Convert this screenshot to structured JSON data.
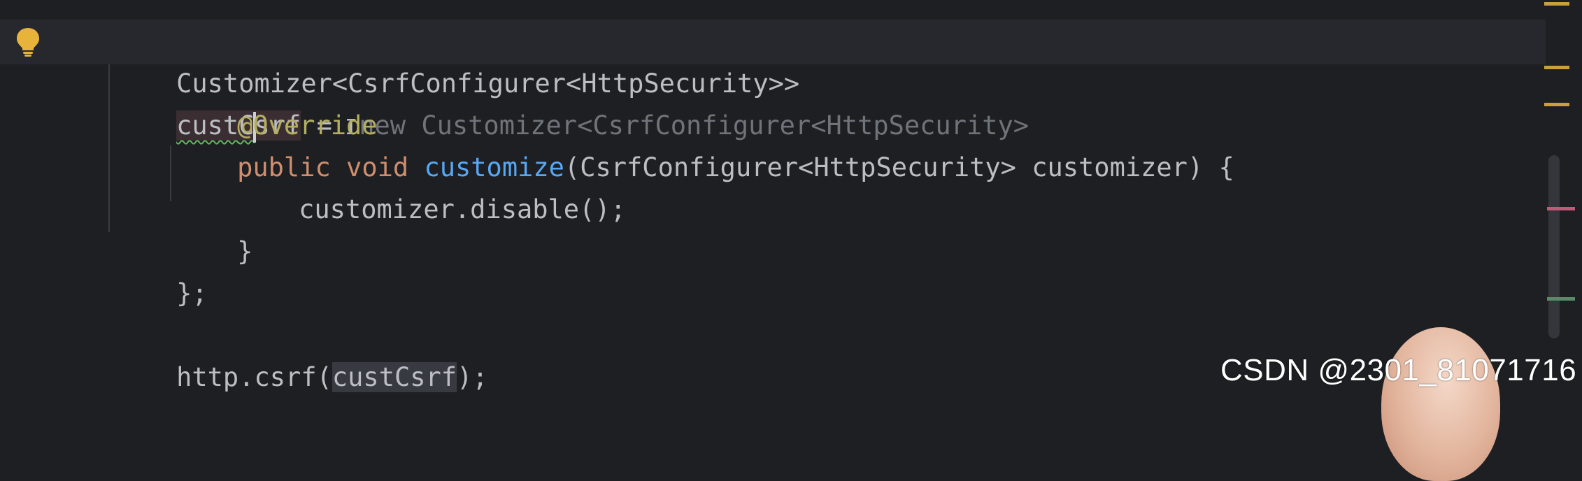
{
  "code": {
    "line1": {
      "type": "Customizer<CsrfConfigurer<HttpSecurity>>",
      "var_a": "cust",
      "var_b": "C",
      "var_c": "srf",
      "assign": " = ",
      "ghost_completion": "new Customizer<CsrfConfigurer<HttpSecurity>"
    },
    "line2": {
      "annotation": "@Override"
    },
    "line3": {
      "kw_public": "public",
      "kw_void": "void",
      "method": "customize",
      "params": "(CsrfConfigurer<HttpSecurity> customizer) {"
    },
    "line4": {
      "text": "customizer.disable();"
    },
    "line5": {
      "text": "}"
    },
    "line6": {
      "text": "};"
    },
    "line7": {
      "prefix": "http.csrf(",
      "ref": "custCsrf",
      "suffix": ");"
    }
  },
  "watermark": "CSDN @2301_81071716",
  "colors": {
    "background": "#1e1f22",
    "keyword": "#cf8e6d",
    "annotation": "#b3ae60",
    "method": "#56a8f5",
    "text": "#bcbec4",
    "bulb": "#e8b33a",
    "marker_warning": "#c9a03d",
    "marker_error": "#c05a78",
    "marker_ok": "#5a8a6a"
  },
  "icons": [
    "lightbulb-icon"
  ]
}
